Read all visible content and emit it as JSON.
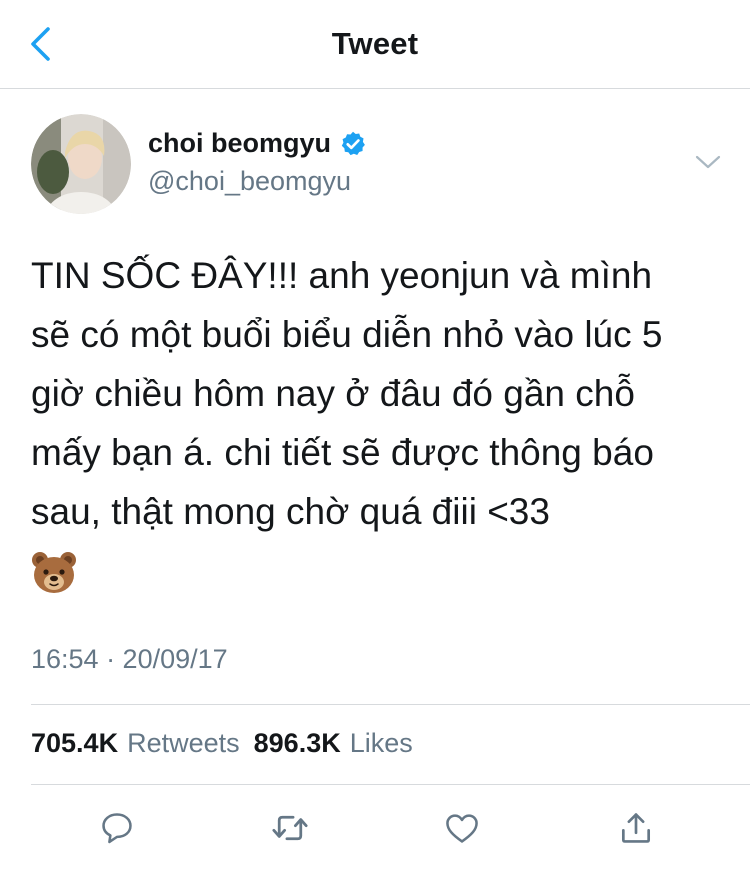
{
  "header": {
    "title": "Tweet",
    "back_icon": "chevron-left-icon"
  },
  "author": {
    "name": "choi beomgyu",
    "handle": "@choi_beomgyu",
    "verified": true,
    "verified_color": "#1da1f2"
  },
  "tweet": {
    "text": "TIN SỐC ĐÂY!!! anh yeonjun và mình\nsẽ có một buổi biểu diễn nhỏ vào lúc 5\ngiờ chiều hôm nay ở đâu đó gần chỗ\nmấy bạn á. chi tiết sẽ được thông báo\nsau, thật mong chờ quá điii <33",
    "emoji": "bear-face-emoji",
    "timestamp": "16:54 · 20/09/17"
  },
  "stats": {
    "retweets_count": "705.4K",
    "retweets_label": "Retweets",
    "likes_count": "896.3K",
    "likes_label": "Likes"
  },
  "actions": [
    {
      "icon": "reply-icon"
    },
    {
      "icon": "retweet-icon"
    },
    {
      "icon": "like-icon"
    },
    {
      "icon": "share-icon"
    }
  ],
  "colors": {
    "accent": "#1da1f2",
    "text": "#14171a",
    "secondary": "#657786",
    "divider": "#d7dadd"
  }
}
